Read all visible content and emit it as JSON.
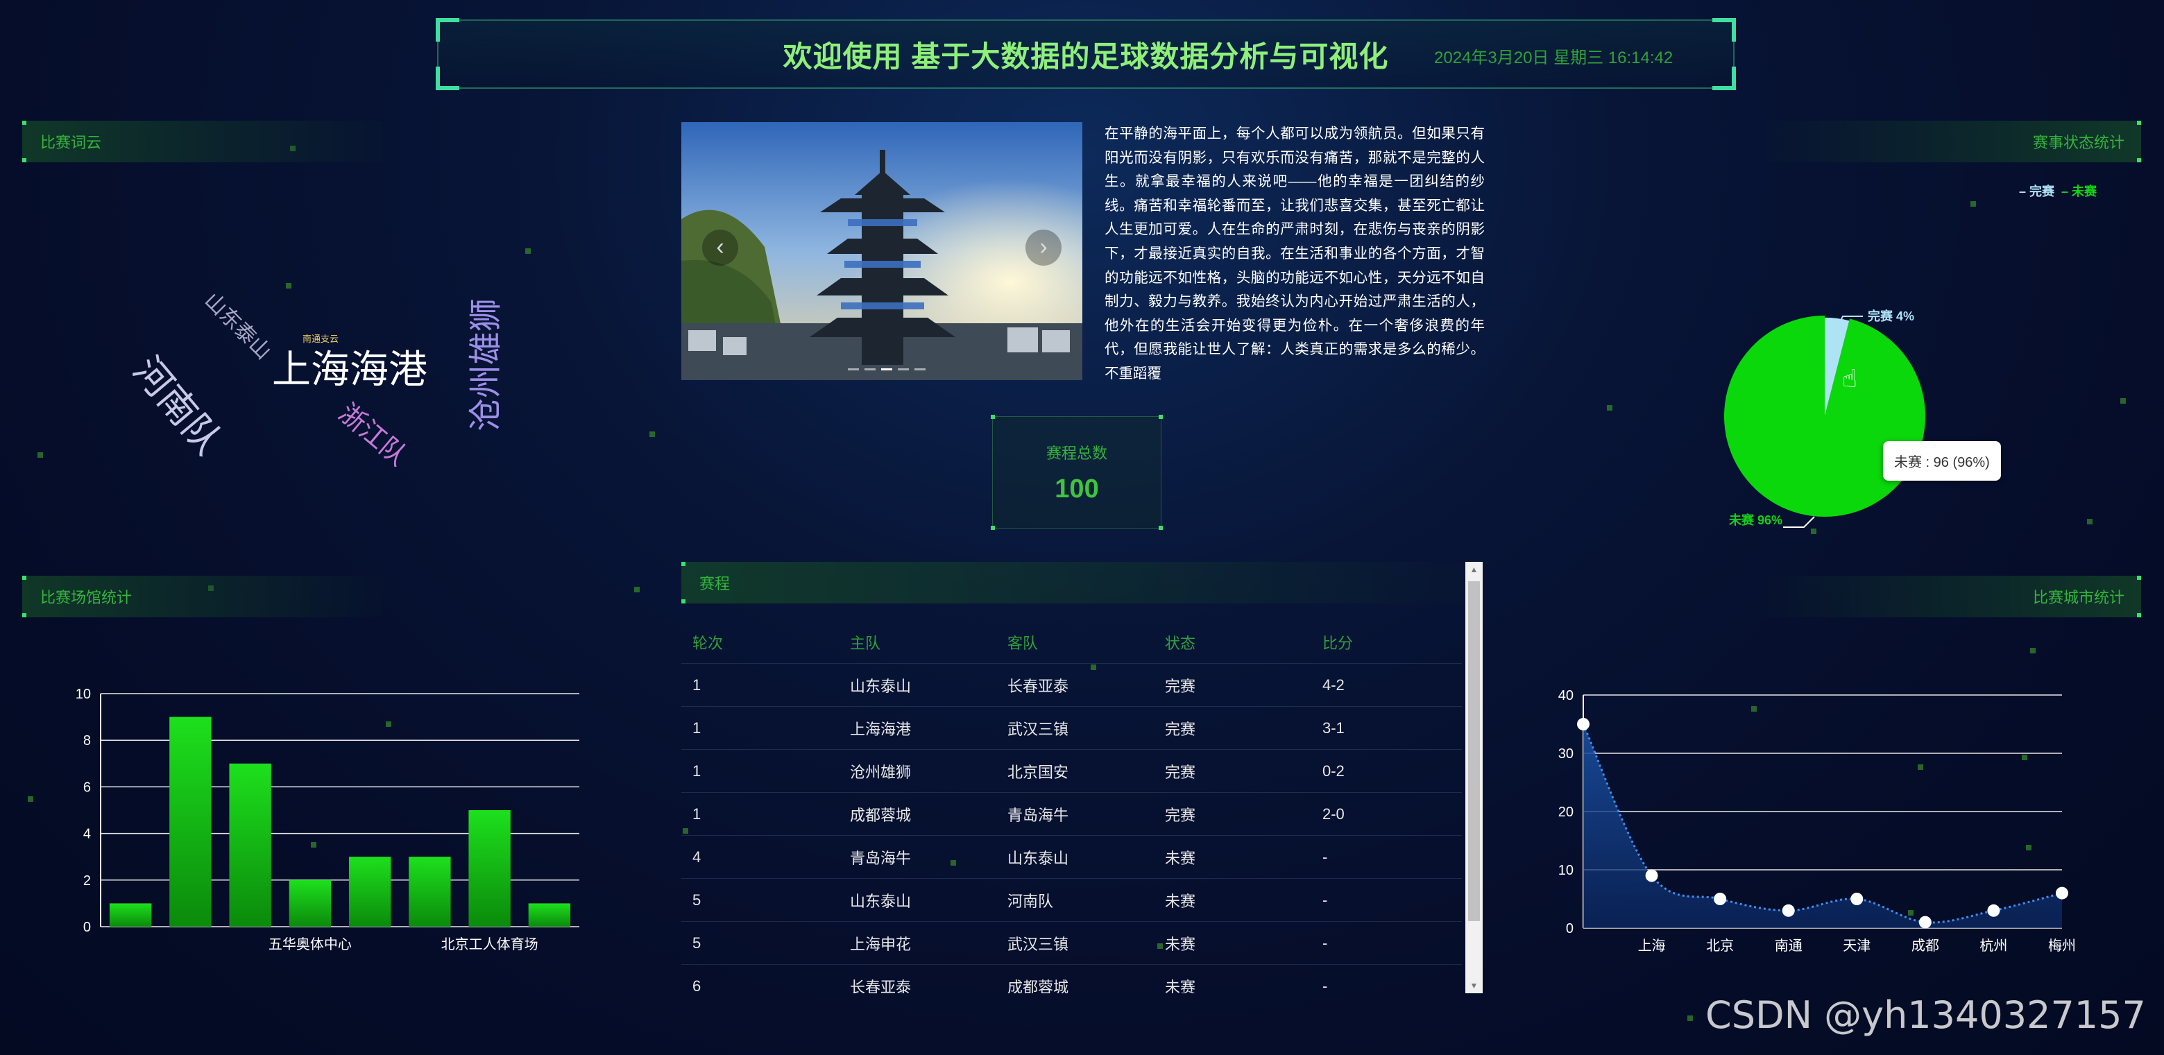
{
  "header": {
    "title": "欢迎使用 基于大数据的足球数据分析与可视化",
    "datetime": "2024年3月20日 星期三 16:14:42"
  },
  "panels": {
    "wordcloud_title": "比赛词云",
    "status_title": "赛事状态统计",
    "venue_title": "比赛场馆统计",
    "city_title": "比赛城市统计",
    "schedule_title": "赛程"
  },
  "wordcloud": [
    {
      "text": "上海海港",
      "color": "#ffffff"
    },
    {
      "text": "河南队",
      "color": "#c8c8e8"
    },
    {
      "text": "沧州雄狮",
      "color": "#9d8fe8"
    },
    {
      "text": "山东泰山",
      "color": "#a7a7c7"
    },
    {
      "text": "浙江队",
      "color": "#c77ad8"
    },
    {
      "text": "南通支云",
      "color": "#f0d060"
    }
  ],
  "carousel": {
    "prev_icon": "‹",
    "next_icon": "›",
    "slides": 5
  },
  "essay": "在平静的海平面上，每个人都可以成为领航员。但如果只有阳光而没有阴影，只有欢乐而没有痛苦，那就不是完整的人生。就拿最幸福的人来说吧——他的幸福是一团纠结的纱线。痛苦和幸福轮番而至，让我们悲喜交集，甚至死亡都让人生更加可爱。人在生命的严肃时刻，在悲伤与丧亲的阴影下，才最接近真实的自我。在生活和事业的各个方面，才智的功能远不如性格，头脑的功能远不如心性，天分远不如自制力、毅力与教养。我始终认为内心开始过严肃生活的人，他外在的生活会开始变得更为俭朴。在一个奢侈浪费的年代，但愿我能让世人了解：人类真正的需求是多么的稀少。不重蹈覆",
  "total": {
    "label": "赛程总数",
    "value": "100"
  },
  "schedule": {
    "headers": [
      "轮次",
      "主队",
      "客队",
      "状态",
      "比分"
    ],
    "rows": [
      [
        "1",
        "山东泰山",
        "长春亚泰",
        "完赛",
        "4-2"
      ],
      [
        "1",
        "上海海港",
        "武汉三镇",
        "完赛",
        "3-1"
      ],
      [
        "1",
        "沧州雄狮",
        "北京国安",
        "完赛",
        "0-2"
      ],
      [
        "1",
        "成都蓉城",
        "青岛海牛",
        "完赛",
        "2-0"
      ],
      [
        "4",
        "青岛海牛",
        "山东泰山",
        "未赛",
        "-"
      ],
      [
        "5",
        "山东泰山",
        "河南队",
        "未赛",
        "-"
      ],
      [
        "5",
        "上海申花",
        "武汉三镇",
        "未赛",
        "-"
      ],
      [
        "6",
        "长春亚泰",
        "成都蓉城",
        "未赛",
        "-"
      ]
    ]
  },
  "tooltip": "未赛 : 96 (96%)",
  "chart_data": [
    {
      "type": "pie",
      "title": "赛事状态统计",
      "legend": [
        "完赛",
        "未赛"
      ],
      "legend_position": "top-right",
      "slices": [
        {
          "name": "完赛",
          "value": 4,
          "label": "完赛 4%",
          "color": "#aee3f5"
        },
        {
          "name": "未赛",
          "value": 96,
          "label": "未赛 96%",
          "color": "#0ad80a"
        }
      ]
    },
    {
      "type": "bar",
      "title": "比赛场馆统计",
      "categories": [
        "",
        "",
        "",
        "五华奥体中心",
        "",
        "",
        "北京工人体育场",
        ""
      ],
      "values": [
        1,
        9,
        7,
        2,
        3,
        3,
        5,
        1
      ],
      "ylim": [
        0,
        10
      ],
      "yticks": [
        "0",
        "2",
        "4",
        "6",
        "8",
        "10"
      ],
      "grid": true,
      "color": "#12d212"
    },
    {
      "type": "area",
      "title": "比赛城市统计",
      "categories": [
        "",
        "上海",
        "北京",
        "南通",
        "天津",
        "成都",
        "杭州",
        "梅州"
      ],
      "values": [
        35,
        9,
        5,
        3,
        5,
        1,
        3,
        6
      ],
      "ylim": [
        0,
        40
      ],
      "yticks": [
        "0",
        "10",
        "20",
        "30",
        "40"
      ],
      "grid": true,
      "color": "#2a6fd0"
    }
  ],
  "watermark": "CSDN @yh1340327157"
}
